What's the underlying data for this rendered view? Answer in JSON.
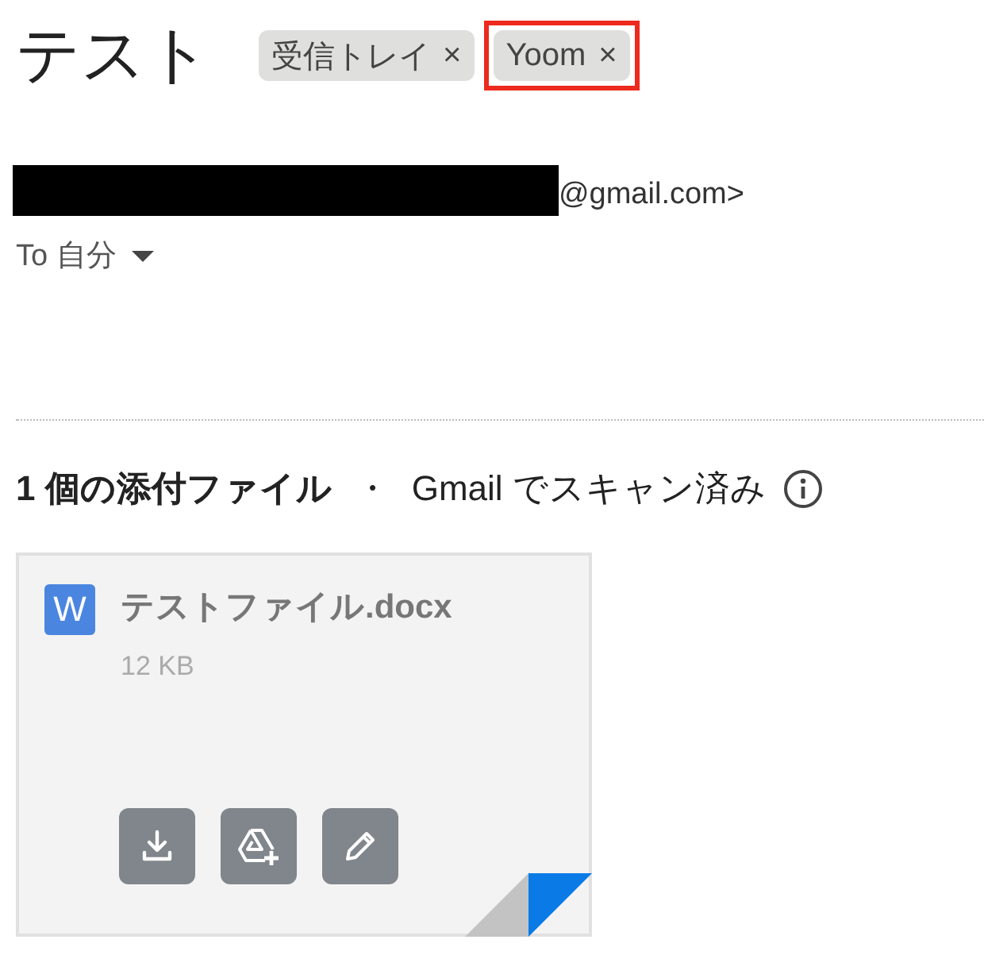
{
  "subject": "テスト",
  "labels": [
    {
      "text": "受信トレイ",
      "close": "×",
      "highlighted": false
    },
    {
      "text": "Yoom",
      "close": "×",
      "highlighted": true
    }
  ],
  "sender": {
    "redacted": true,
    "address": "@gmail.com>"
  },
  "recipient": {
    "text": "To 自分"
  },
  "attachments_header": {
    "count": "1 個の添付ファイル",
    "separator": "・",
    "scan": "Gmail でスキャン済み"
  },
  "attachments": [
    {
      "icon_letter": "W",
      "name": "テストファイル.docx",
      "size": "12 KB",
      "actions": [
        {
          "kind": "download"
        },
        {
          "kind": "drive"
        },
        {
          "kind": "edit"
        }
      ]
    }
  ]
}
